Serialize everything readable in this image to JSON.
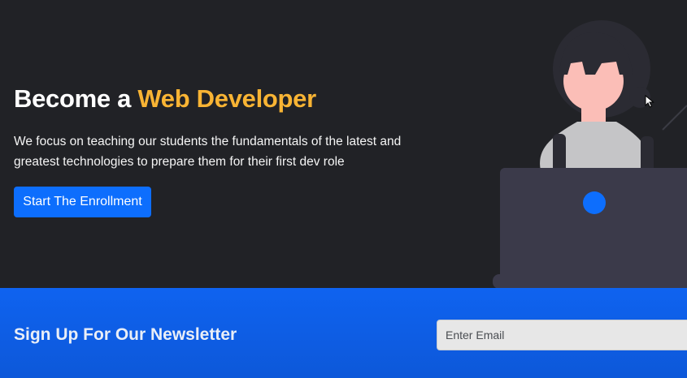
{
  "hero": {
    "title_prefix": "Become a ",
    "title_accent": "Web Developer",
    "description": "We focus on teaching our students the fundamentals of the latest and greatest technologies to prepare them for their first dev role",
    "cta_label": "Start The Enrollment"
  },
  "newsletter": {
    "title": "Sign Up For Our Newsletter",
    "email_placeholder": "Enter Email",
    "email_value": ""
  },
  "colors": {
    "background": "#212226",
    "accent": "#f8b434",
    "primary": "#0d6efd",
    "newsletter_bg": "#0f63f0"
  },
  "icons": {
    "illustration": "developer-at-laptop-illustration",
    "cursor": "mouse-pointer-icon"
  }
}
